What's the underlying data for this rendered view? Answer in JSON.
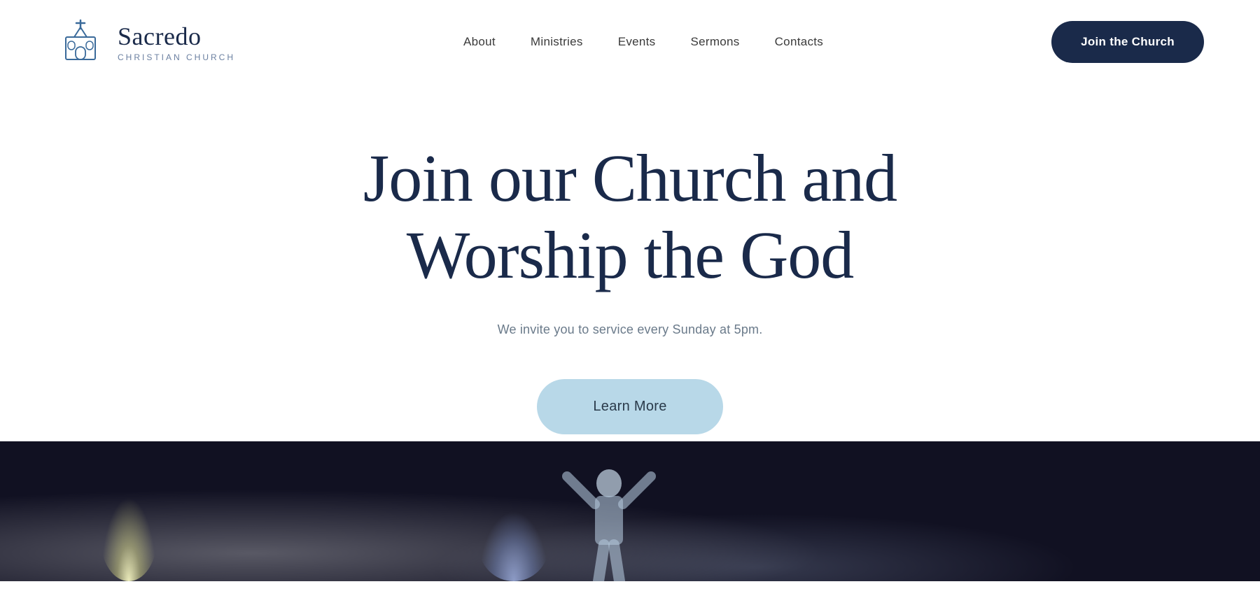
{
  "site": {
    "logo_name": "Sacredo",
    "logo_subtitle": "CHRISTIAN CHURCH"
  },
  "nav": {
    "items": [
      {
        "label": "About",
        "href": "#"
      },
      {
        "label": "Ministries",
        "href": "#"
      },
      {
        "label": "Events",
        "href": "#"
      },
      {
        "label": "Sermons",
        "href": "#"
      },
      {
        "label": "Contacts",
        "href": "#"
      }
    ],
    "cta_label": "Join the Church"
  },
  "hero": {
    "title_line1": "Join our Church and",
    "title_line2": "Worship the God",
    "subtitle": "We invite you to service every Sunday at 5pm.",
    "learn_more_label": "Learn More"
  },
  "colors": {
    "brand_dark": "#1a2a4a",
    "btn_light_blue": "#b8d8e8",
    "text_gray": "#6a7a8a"
  }
}
